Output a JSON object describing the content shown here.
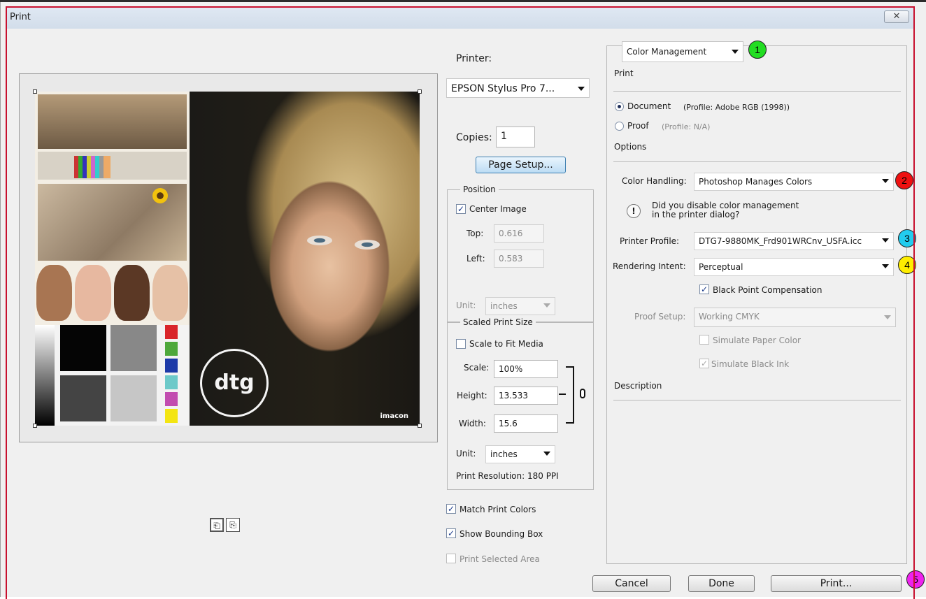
{
  "window": {
    "title": "Print",
    "close_glyph": "✕"
  },
  "printer": {
    "label": "Printer:",
    "value": "EPSON Stylus Pro 7...",
    "copies_label": "Copies:",
    "copies_value": "1",
    "page_setup_label": "Page Setup..."
  },
  "position": {
    "title": "Position",
    "center_image_label": "Center Image",
    "center_image_checked": true,
    "top_label": "Top:",
    "top_value": "0.616",
    "left_label": "Left:",
    "left_value": "0.583",
    "unit_label": "Unit:",
    "unit_value": "inches"
  },
  "scaled": {
    "title": "Scaled Print Size",
    "scale_to_fit_label": "Scale to Fit Media",
    "scale_label": "Scale:",
    "scale_value": "100%",
    "height_label": "Height:",
    "height_value": "13.533",
    "width_label": "Width:",
    "width_value": "15.6",
    "unit_label": "Unit:",
    "unit_value": "inches",
    "resolution_text": "Print Resolution: 180 PPI"
  },
  "options_bottom": {
    "match_print_colors": "Match Print Colors",
    "show_bounding_box": "Show Bounding Box",
    "print_selected_area": "Print Selected Area"
  },
  "preview": {
    "brand_text": "imacon",
    "logo_text": "dtg"
  },
  "color_mgmt": {
    "section_select": "Color Management",
    "print_heading": "Print",
    "document_label": "Document",
    "document_profile": "(Profile: Adobe RGB (1998))",
    "proof_label": "Proof",
    "proof_profile": "(Profile: N/A)",
    "options_heading": "Options",
    "color_handling_label": "Color Handling:",
    "color_handling_value": "Photoshop Manages Colors",
    "info_line1": "Did you disable color management",
    "info_line2": "in the printer dialog?",
    "printer_profile_label": "Printer Profile:",
    "printer_profile_value": "DTG7-9880MK_Frd901WRCnv_USFA.icc",
    "rendering_intent_label": "Rendering Intent:",
    "rendering_intent_value": "Perceptual",
    "black_point_label": "Black Point Compensation",
    "proof_setup_label": "Proof Setup:",
    "proof_setup_value": "Working CMYK",
    "simulate_paper_label": "Simulate Paper Color",
    "simulate_ink_label": "Simulate Black Ink",
    "description_heading": "Description"
  },
  "buttons": {
    "cancel": "Cancel",
    "done": "Done",
    "print": "Print..."
  },
  "badges": [
    {
      "n": "1",
      "color": "#22dd22"
    },
    {
      "n": "2",
      "color": "#ee1111"
    },
    {
      "n": "3",
      "color": "#22ccee"
    },
    {
      "n": "4",
      "color": "#ffee00"
    },
    {
      "n": "5",
      "color": "#ee22ee"
    }
  ]
}
